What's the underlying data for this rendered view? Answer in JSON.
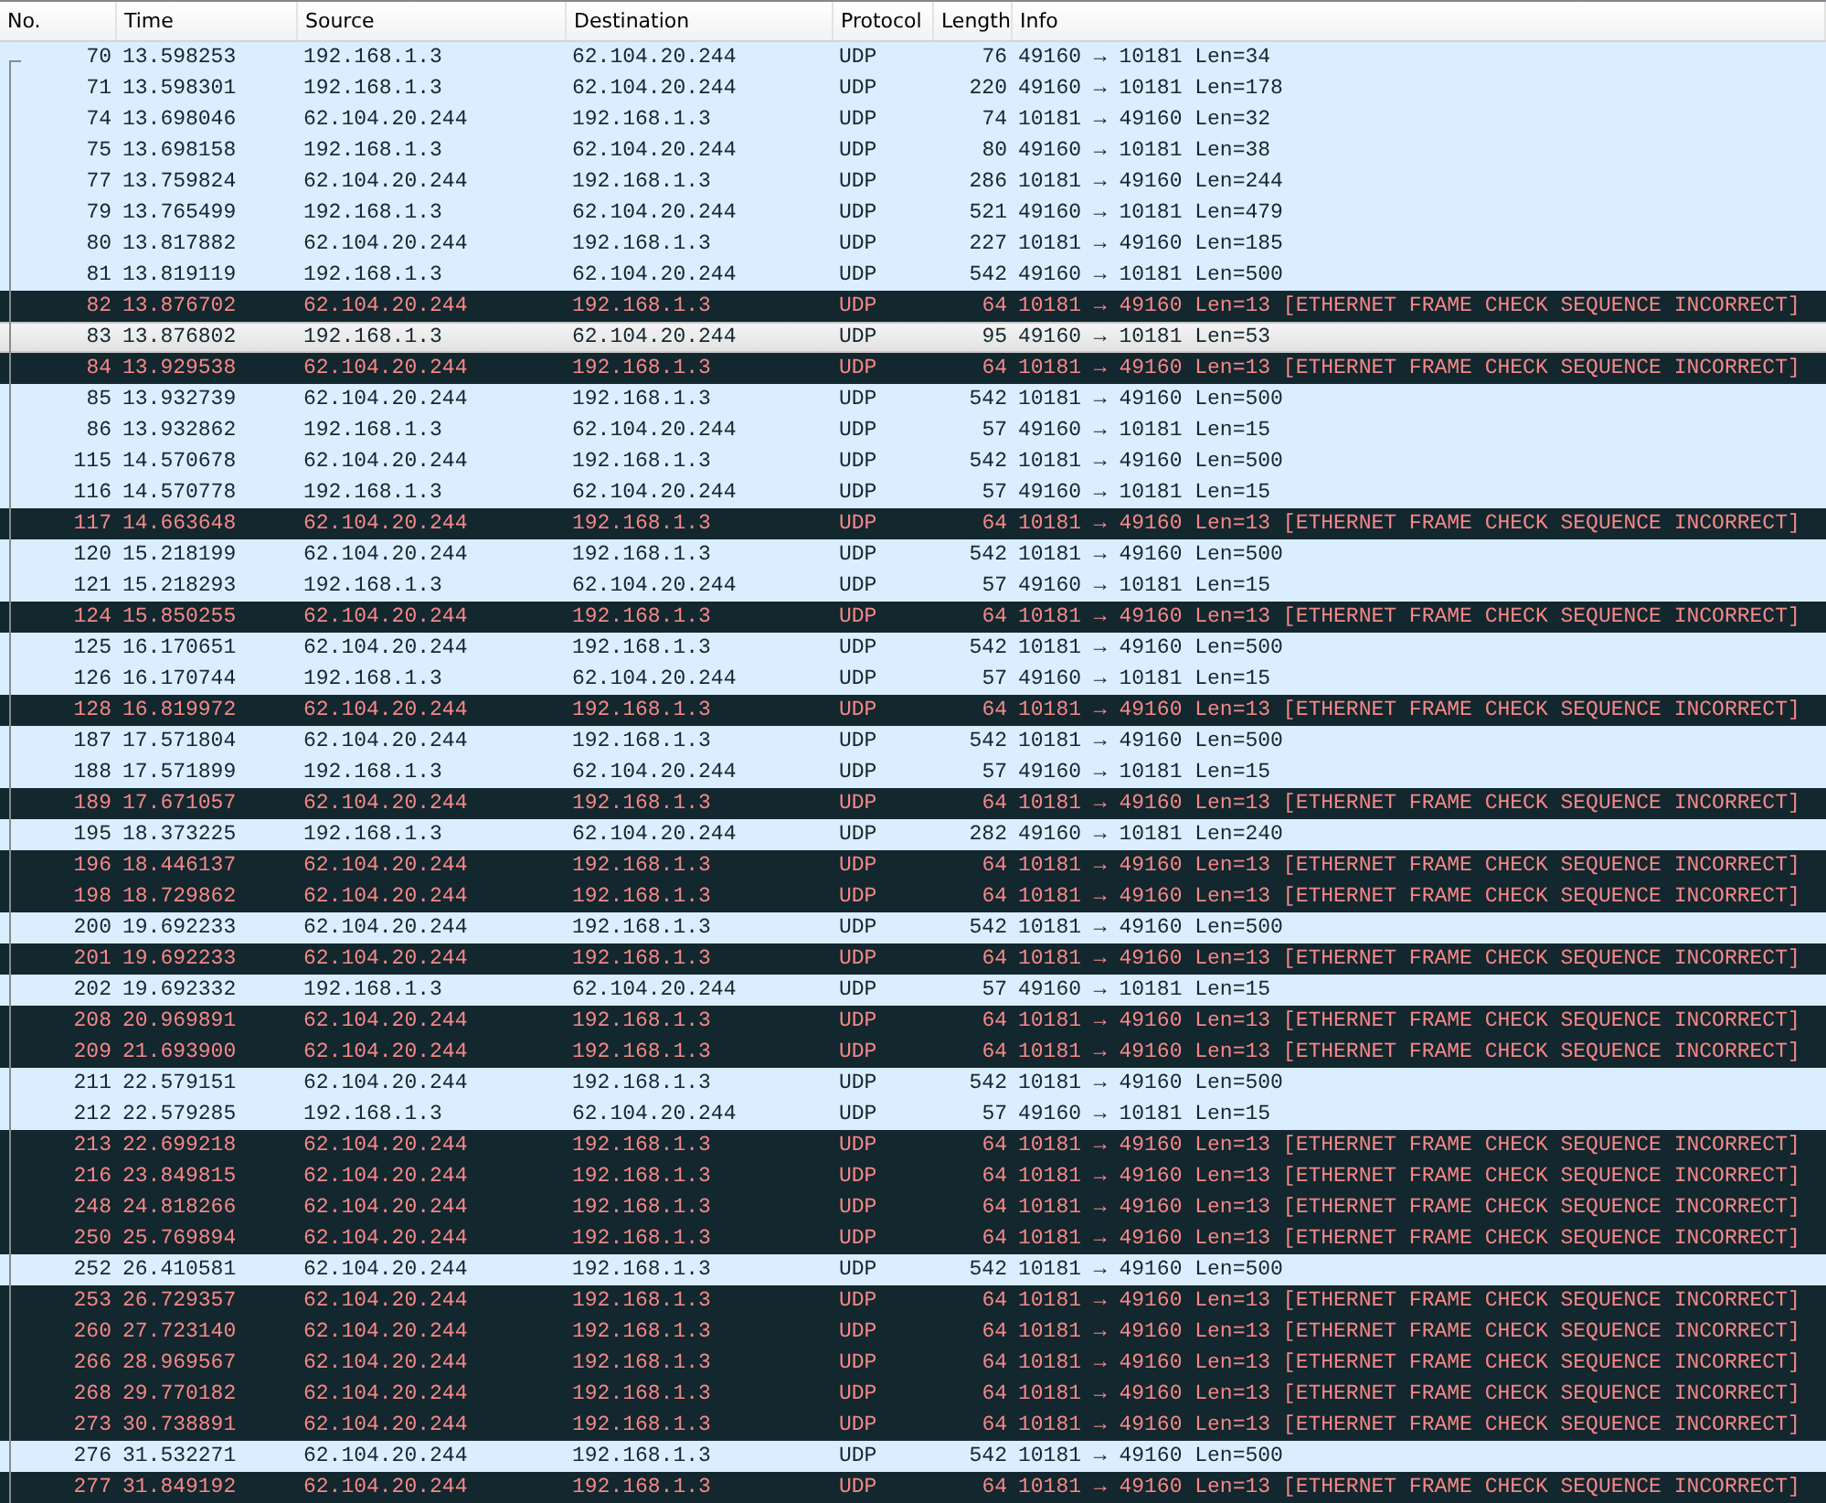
{
  "table": {
    "columns": [
      "No.",
      "Time",
      "Source",
      "Destination",
      "Protocol",
      "Length",
      "Info"
    ],
    "rows": [
      {
        "no": "70",
        "time": "13.598253",
        "source": "192.168.1.3",
        "destination": "62.104.20.244",
        "protocol": "UDP",
        "length": "76",
        "info": "49160 → 10181 Len=34",
        "kind": "normal",
        "selected": false
      },
      {
        "no": "71",
        "time": "13.598301",
        "source": "192.168.1.3",
        "destination": "62.104.20.244",
        "protocol": "UDP",
        "length": "220",
        "info": "49160 → 10181 Len=178",
        "kind": "normal",
        "selected": false
      },
      {
        "no": "74",
        "time": "13.698046",
        "source": "62.104.20.244",
        "destination": "192.168.1.3",
        "protocol": "UDP",
        "length": "74",
        "info": "10181 → 49160 Len=32",
        "kind": "normal",
        "selected": false
      },
      {
        "no": "75",
        "time": "13.698158",
        "source": "192.168.1.3",
        "destination": "62.104.20.244",
        "protocol": "UDP",
        "length": "80",
        "info": "49160 → 10181 Len=38",
        "kind": "normal",
        "selected": false
      },
      {
        "no": "77",
        "time": "13.759824",
        "source": "62.104.20.244",
        "destination": "192.168.1.3",
        "protocol": "UDP",
        "length": "286",
        "info": "10181 → 49160 Len=244",
        "kind": "normal",
        "selected": false
      },
      {
        "no": "79",
        "time": "13.765499",
        "source": "192.168.1.3",
        "destination": "62.104.20.244",
        "protocol": "UDP",
        "length": "521",
        "info": "49160 → 10181 Len=479",
        "kind": "normal",
        "selected": false
      },
      {
        "no": "80",
        "time": "13.817882",
        "source": "62.104.20.244",
        "destination": "192.168.1.3",
        "protocol": "UDP",
        "length": "227",
        "info": "10181 → 49160 Len=185",
        "kind": "normal",
        "selected": false
      },
      {
        "no": "81",
        "time": "13.819119",
        "source": "192.168.1.3",
        "destination": "62.104.20.244",
        "protocol": "UDP",
        "length": "542",
        "info": "49160 → 10181 Len=500",
        "kind": "normal",
        "selected": false
      },
      {
        "no": "82",
        "time": "13.876702",
        "source": "62.104.20.244",
        "destination": "192.168.1.3",
        "protocol": "UDP",
        "length": "64",
        "info": "10181 → 49160 Len=13 [ETHERNET FRAME CHECK SEQUENCE INCORRECT]",
        "kind": "error",
        "selected": false
      },
      {
        "no": "83",
        "time": "13.876802",
        "source": "192.168.1.3",
        "destination": "62.104.20.244",
        "protocol": "UDP",
        "length": "95",
        "info": "49160 → 10181 Len=53",
        "kind": "normal",
        "selected": true
      },
      {
        "no": "84",
        "time": "13.929538",
        "source": "62.104.20.244",
        "destination": "192.168.1.3",
        "protocol": "UDP",
        "length": "64",
        "info": "10181 → 49160 Len=13 [ETHERNET FRAME CHECK SEQUENCE INCORRECT]",
        "kind": "error",
        "selected": false
      },
      {
        "no": "85",
        "time": "13.932739",
        "source": "62.104.20.244",
        "destination": "192.168.1.3",
        "protocol": "UDP",
        "length": "542",
        "info": "10181 → 49160 Len=500",
        "kind": "normal",
        "selected": false
      },
      {
        "no": "86",
        "time": "13.932862",
        "source": "192.168.1.3",
        "destination": "62.104.20.244",
        "protocol": "UDP",
        "length": "57",
        "info": "49160 → 10181 Len=15",
        "kind": "normal",
        "selected": false
      },
      {
        "no": "115",
        "time": "14.570678",
        "source": "62.104.20.244",
        "destination": "192.168.1.3",
        "protocol": "UDP",
        "length": "542",
        "info": "10181 → 49160 Len=500",
        "kind": "normal",
        "selected": false
      },
      {
        "no": "116",
        "time": "14.570778",
        "source": "192.168.1.3",
        "destination": "62.104.20.244",
        "protocol": "UDP",
        "length": "57",
        "info": "49160 → 10181 Len=15",
        "kind": "normal",
        "selected": false
      },
      {
        "no": "117",
        "time": "14.663648",
        "source": "62.104.20.244",
        "destination": "192.168.1.3",
        "protocol": "UDP",
        "length": "64",
        "info": "10181 → 49160 Len=13 [ETHERNET FRAME CHECK SEQUENCE INCORRECT]",
        "kind": "error",
        "selected": false
      },
      {
        "no": "120",
        "time": "15.218199",
        "source": "62.104.20.244",
        "destination": "192.168.1.3",
        "protocol": "UDP",
        "length": "542",
        "info": "10181 → 49160 Len=500",
        "kind": "normal",
        "selected": false
      },
      {
        "no": "121",
        "time": "15.218293",
        "source": "192.168.1.3",
        "destination": "62.104.20.244",
        "protocol": "UDP",
        "length": "57",
        "info": "49160 → 10181 Len=15",
        "kind": "normal",
        "selected": false
      },
      {
        "no": "124",
        "time": "15.850255",
        "source": "62.104.20.244",
        "destination": "192.168.1.3",
        "protocol": "UDP",
        "length": "64",
        "info": "10181 → 49160 Len=13 [ETHERNET FRAME CHECK SEQUENCE INCORRECT]",
        "kind": "error",
        "selected": false
      },
      {
        "no": "125",
        "time": "16.170651",
        "source": "62.104.20.244",
        "destination": "192.168.1.3",
        "protocol": "UDP",
        "length": "542",
        "info": "10181 → 49160 Len=500",
        "kind": "normal",
        "selected": false
      },
      {
        "no": "126",
        "time": "16.170744",
        "source": "192.168.1.3",
        "destination": "62.104.20.244",
        "protocol": "UDP",
        "length": "57",
        "info": "49160 → 10181 Len=15",
        "kind": "normal",
        "selected": false
      },
      {
        "no": "128",
        "time": "16.819972",
        "source": "62.104.20.244",
        "destination": "192.168.1.3",
        "protocol": "UDP",
        "length": "64",
        "info": "10181 → 49160 Len=13 [ETHERNET FRAME CHECK SEQUENCE INCORRECT]",
        "kind": "error",
        "selected": false
      },
      {
        "no": "187",
        "time": "17.571804",
        "source": "62.104.20.244",
        "destination": "192.168.1.3",
        "protocol": "UDP",
        "length": "542",
        "info": "10181 → 49160 Len=500",
        "kind": "normal",
        "selected": false
      },
      {
        "no": "188",
        "time": "17.571899",
        "source": "192.168.1.3",
        "destination": "62.104.20.244",
        "protocol": "UDP",
        "length": "57",
        "info": "49160 → 10181 Len=15",
        "kind": "normal",
        "selected": false
      },
      {
        "no": "189",
        "time": "17.671057",
        "source": "62.104.20.244",
        "destination": "192.168.1.3",
        "protocol": "UDP",
        "length": "64",
        "info": "10181 → 49160 Len=13 [ETHERNET FRAME CHECK SEQUENCE INCORRECT]",
        "kind": "error",
        "selected": false
      },
      {
        "no": "195",
        "time": "18.373225",
        "source": "192.168.1.3",
        "destination": "62.104.20.244",
        "protocol": "UDP",
        "length": "282",
        "info": "49160 → 10181 Len=240",
        "kind": "normal",
        "selected": false
      },
      {
        "no": "196",
        "time": "18.446137",
        "source": "62.104.20.244",
        "destination": "192.168.1.3",
        "protocol": "UDP",
        "length": "64",
        "info": "10181 → 49160 Len=13 [ETHERNET FRAME CHECK SEQUENCE INCORRECT]",
        "kind": "error",
        "selected": false
      },
      {
        "no": "198",
        "time": "18.729862",
        "source": "62.104.20.244",
        "destination": "192.168.1.3",
        "protocol": "UDP",
        "length": "64",
        "info": "10181 → 49160 Len=13 [ETHERNET FRAME CHECK SEQUENCE INCORRECT]",
        "kind": "error",
        "selected": false
      },
      {
        "no": "200",
        "time": "19.692233",
        "source": "62.104.20.244",
        "destination": "192.168.1.3",
        "protocol": "UDP",
        "length": "542",
        "info": "10181 → 49160 Len=500",
        "kind": "normal",
        "selected": false
      },
      {
        "no": "201",
        "time": "19.692233",
        "source": "62.104.20.244",
        "destination": "192.168.1.3",
        "protocol": "UDP",
        "length": "64",
        "info": "10181 → 49160 Len=13 [ETHERNET FRAME CHECK SEQUENCE INCORRECT]",
        "kind": "error",
        "selected": false
      },
      {
        "no": "202",
        "time": "19.692332",
        "source": "192.168.1.3",
        "destination": "62.104.20.244",
        "protocol": "UDP",
        "length": "57",
        "info": "49160 → 10181 Len=15",
        "kind": "normal",
        "selected": false
      },
      {
        "no": "208",
        "time": "20.969891",
        "source": "62.104.20.244",
        "destination": "192.168.1.3",
        "protocol": "UDP",
        "length": "64",
        "info": "10181 → 49160 Len=13 [ETHERNET FRAME CHECK SEQUENCE INCORRECT]",
        "kind": "error",
        "selected": false
      },
      {
        "no": "209",
        "time": "21.693900",
        "source": "62.104.20.244",
        "destination": "192.168.1.3",
        "protocol": "UDP",
        "length": "64",
        "info": "10181 → 49160 Len=13 [ETHERNET FRAME CHECK SEQUENCE INCORRECT]",
        "kind": "error",
        "selected": false
      },
      {
        "no": "211",
        "time": "22.579151",
        "source": "62.104.20.244",
        "destination": "192.168.1.3",
        "protocol": "UDP",
        "length": "542",
        "info": "10181 → 49160 Len=500",
        "kind": "normal",
        "selected": false
      },
      {
        "no": "212",
        "time": "22.579285",
        "source": "192.168.1.3",
        "destination": "62.104.20.244",
        "protocol": "UDP",
        "length": "57",
        "info": "49160 → 10181 Len=15",
        "kind": "normal",
        "selected": false
      },
      {
        "no": "213",
        "time": "22.699218",
        "source": "62.104.20.244",
        "destination": "192.168.1.3",
        "protocol": "UDP",
        "length": "64",
        "info": "10181 → 49160 Len=13 [ETHERNET FRAME CHECK SEQUENCE INCORRECT]",
        "kind": "error",
        "selected": false
      },
      {
        "no": "216",
        "time": "23.849815",
        "source": "62.104.20.244",
        "destination": "192.168.1.3",
        "protocol": "UDP",
        "length": "64",
        "info": "10181 → 49160 Len=13 [ETHERNET FRAME CHECK SEQUENCE INCORRECT]",
        "kind": "error",
        "selected": false
      },
      {
        "no": "248",
        "time": "24.818266",
        "source": "62.104.20.244",
        "destination": "192.168.1.3",
        "protocol": "UDP",
        "length": "64",
        "info": "10181 → 49160 Len=13 [ETHERNET FRAME CHECK SEQUENCE INCORRECT]",
        "kind": "error",
        "selected": false
      },
      {
        "no": "250",
        "time": "25.769894",
        "source": "62.104.20.244",
        "destination": "192.168.1.3",
        "protocol": "UDP",
        "length": "64",
        "info": "10181 → 49160 Len=13 [ETHERNET FRAME CHECK SEQUENCE INCORRECT]",
        "kind": "error",
        "selected": false
      },
      {
        "no": "252",
        "time": "26.410581",
        "source": "62.104.20.244",
        "destination": "192.168.1.3",
        "protocol": "UDP",
        "length": "542",
        "info": "10181 → 49160 Len=500",
        "kind": "normal",
        "selected": false
      },
      {
        "no": "253",
        "time": "26.729357",
        "source": "62.104.20.244",
        "destination": "192.168.1.3",
        "protocol": "UDP",
        "length": "64",
        "info": "10181 → 49160 Len=13 [ETHERNET FRAME CHECK SEQUENCE INCORRECT]",
        "kind": "error",
        "selected": false
      },
      {
        "no": "260",
        "time": "27.723140",
        "source": "62.104.20.244",
        "destination": "192.168.1.3",
        "protocol": "UDP",
        "length": "64",
        "info": "10181 → 49160 Len=13 [ETHERNET FRAME CHECK SEQUENCE INCORRECT]",
        "kind": "error",
        "selected": false
      },
      {
        "no": "266",
        "time": "28.969567",
        "source": "62.104.20.244",
        "destination": "192.168.1.3",
        "protocol": "UDP",
        "length": "64",
        "info": "10181 → 49160 Len=13 [ETHERNET FRAME CHECK SEQUENCE INCORRECT]",
        "kind": "error",
        "selected": false
      },
      {
        "no": "268",
        "time": "29.770182",
        "source": "62.104.20.244",
        "destination": "192.168.1.3",
        "protocol": "UDP",
        "length": "64",
        "info": "10181 → 49160 Len=13 [ETHERNET FRAME CHECK SEQUENCE INCORRECT]",
        "kind": "error",
        "selected": false
      },
      {
        "no": "273",
        "time": "30.738891",
        "source": "62.104.20.244",
        "destination": "192.168.1.3",
        "protocol": "UDP",
        "length": "64",
        "info": "10181 → 49160 Len=13 [ETHERNET FRAME CHECK SEQUENCE INCORRECT]",
        "kind": "error",
        "selected": false
      },
      {
        "no": "276",
        "time": "31.532271",
        "source": "62.104.20.244",
        "destination": "192.168.1.3",
        "protocol": "UDP",
        "length": "542",
        "info": "10181 → 49160 Len=500",
        "kind": "normal",
        "selected": false
      },
      {
        "no": "277",
        "time": "31.849192",
        "source": "62.104.20.244",
        "destination": "192.168.1.3",
        "protocol": "UDP",
        "length": "64",
        "info": "10181 → 49160 Len=13 [ETHERNET FRAME CHECK SEQUENCE INCORRECT]",
        "kind": "error",
        "selected": false
      }
    ]
  }
}
